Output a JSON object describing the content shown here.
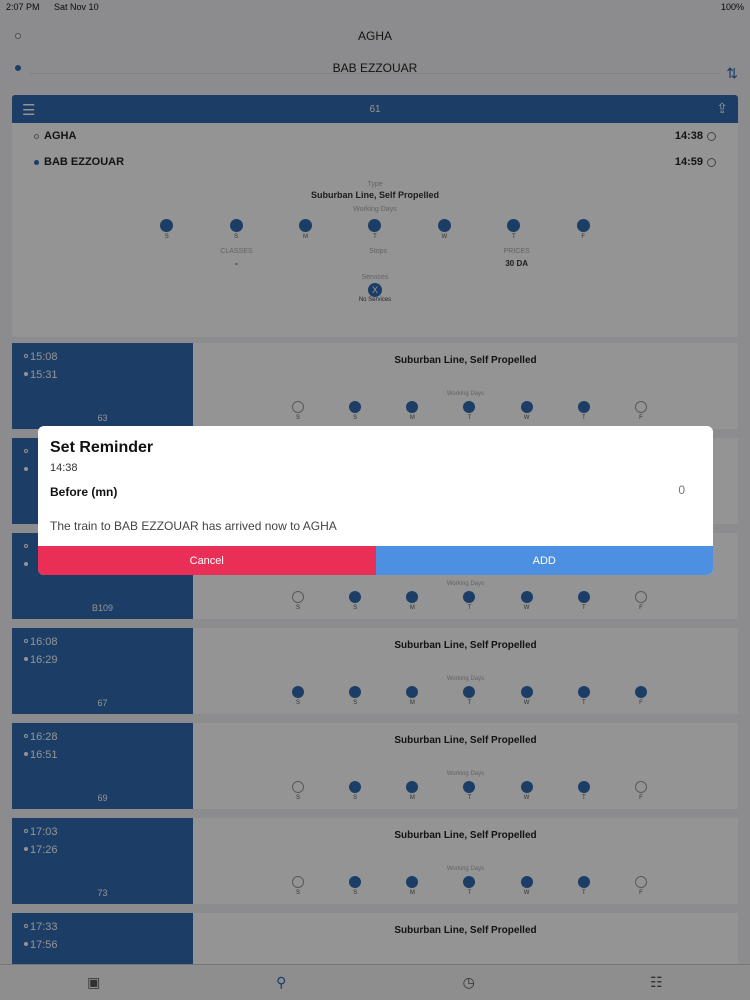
{
  "status": {
    "time": "2:07 PM",
    "date": "Sat Nov 10",
    "battery": "100%"
  },
  "route": {
    "from": "AGHA",
    "to": "BAB EZZOUAR"
  },
  "detail": {
    "number": "61",
    "stops": [
      {
        "name": "AGHA",
        "time": "14:38"
      },
      {
        "name": "BAB EZZOUAR",
        "time": "14:59"
      }
    ],
    "type_caption": "Type",
    "type": "Suburban Line, Self Propelled",
    "working_days_caption": "Working Days",
    "days": [
      "S",
      "S",
      "M",
      "T",
      "W",
      "T",
      "F"
    ],
    "classes_caption": "CLASSES",
    "classes": "-",
    "middle_caption": "Stops",
    "middle_value": "",
    "price_caption": "PRICES",
    "price": "30 DA",
    "services_caption": "Services",
    "services_icon": "X",
    "services_text": "No Services"
  },
  "trips": [
    {
      "dep": "15:08",
      "arr": "15:31",
      "num": "63",
      "type": "Suburban Line, Self Propelled",
      "wd": "Working Days",
      "days_on": [
        0,
        1,
        1,
        1,
        1,
        1,
        0
      ]
    },
    {
      "dep": "",
      "arr": "",
      "num": "",
      "type": "",
      "wd": "",
      "days_on": [
        0,
        1,
        1,
        1,
        1,
        1,
        0
      ]
    },
    {
      "dep": "",
      "arr": "",
      "num": "B109",
      "type": "",
      "wd": "Working Days",
      "days_on": [
        0,
        1,
        1,
        1,
        1,
        1,
        0
      ]
    },
    {
      "dep": "16:08",
      "arr": "16:29",
      "num": "67",
      "type": "Suburban Line, Self Propelled",
      "wd": "Working Days",
      "days_on": [
        1,
        1,
        1,
        1,
        1,
        1,
        1
      ]
    },
    {
      "dep": "16:28",
      "arr": "16:51",
      "num": "69",
      "type": "Suburban Line, Self Propelled",
      "wd": "Working Days",
      "days_on": [
        0,
        1,
        1,
        1,
        1,
        1,
        0
      ]
    },
    {
      "dep": "17:03",
      "arr": "17:26",
      "num": "73",
      "type": "Suburban Line, Self Propelled",
      "wd": "Working Days",
      "days_on": [
        0,
        1,
        1,
        1,
        1,
        1,
        0
      ]
    },
    {
      "dep": "17:33",
      "arr": "17:56",
      "num": "",
      "type": "Suburban Line, Self Propelled",
      "wd": "",
      "days_on": []
    }
  ],
  "dialog": {
    "title": "Set Reminder",
    "time": "14:38",
    "before_label": "Before (mn)",
    "before_value": "0",
    "message": "The train to BAB EZZOUAR has arrived now to AGHA",
    "cancel": "Cancel",
    "add": "ADD"
  },
  "tabs": [
    "train-icon",
    "search-icon",
    "history-icon",
    "settings-icon"
  ],
  "colors": {
    "primary": "#2f6ab0",
    "cancel": "#ea2f56",
    "add": "#4d8fe0"
  }
}
